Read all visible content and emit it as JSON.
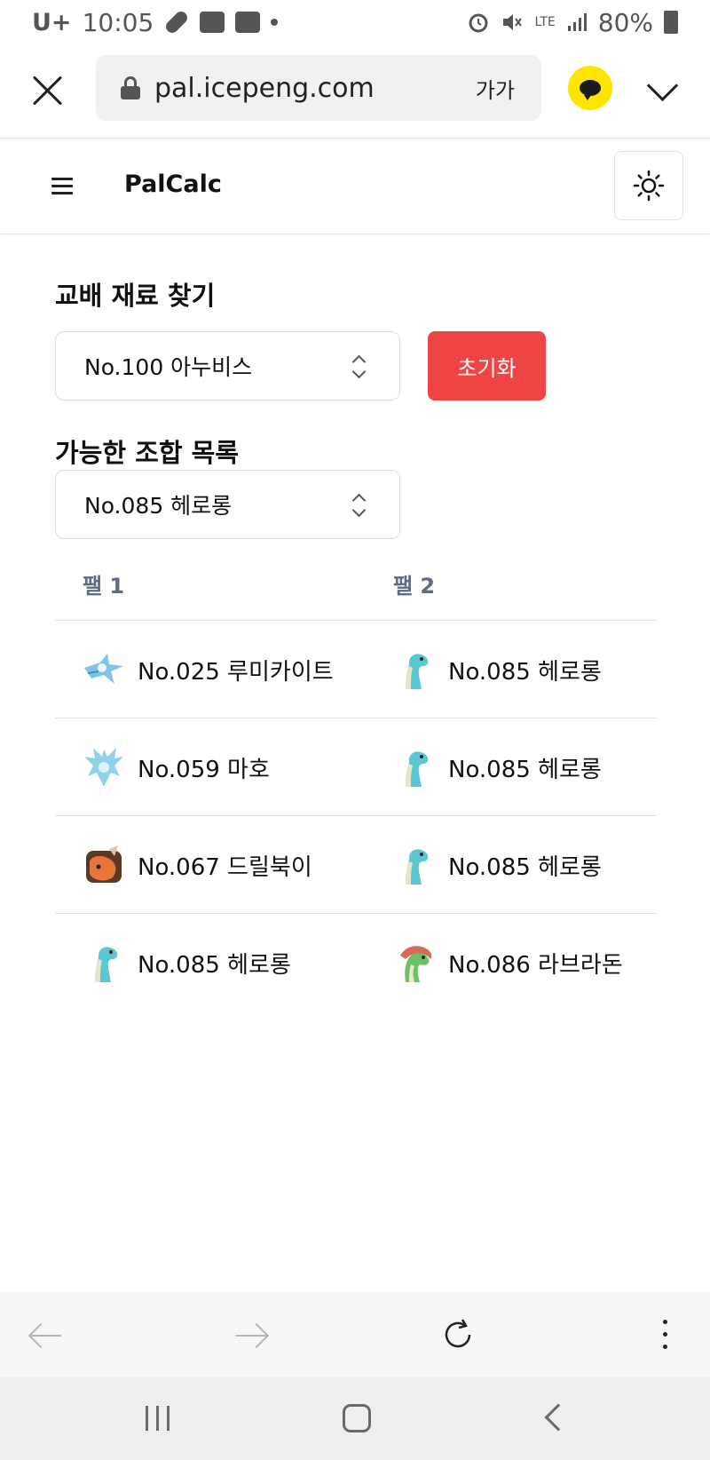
{
  "status_bar": {
    "carrier": "U+",
    "time": "10:05",
    "network": "LTE",
    "battery": "80%"
  },
  "browser": {
    "url": "pal.icepeng.com",
    "text_size_label": "가가"
  },
  "app": {
    "title": "PalCalc"
  },
  "finder": {
    "heading": "교배 재료 찾기",
    "target_select_value": "No.100 아누비스",
    "reset_label": "초기화"
  },
  "combos": {
    "heading": "가능한 조합 목록",
    "filter_select_value": "No.085 헤로롱",
    "columns": [
      "팰 1",
      "팰 2"
    ],
    "rows": [
      {
        "pal1": "No.025 루미카이트",
        "pal1_icon": "lumikite-icon",
        "pal2": "No.085 헤로롱",
        "pal2_icon": "herolong-icon"
      },
      {
        "pal1": "No.059 마호",
        "pal1_icon": "maho-icon",
        "pal2": "No.085 헤로롱",
        "pal2_icon": "herolong-icon"
      },
      {
        "pal1": "No.067 드릴북이",
        "pal1_icon": "drillbuki-icon",
        "pal2": "No.085 헤로롱",
        "pal2_icon": "herolong-icon"
      },
      {
        "pal1": "No.085 헤로롱",
        "pal1_icon": "herolong-icon",
        "pal2": "No.086 라브라돈",
        "pal2_icon": "labradon-icon"
      }
    ]
  },
  "colors": {
    "reset_button": "#ee4444",
    "kakao_yellow": "#fee500",
    "column_header": "#5e6b82"
  }
}
